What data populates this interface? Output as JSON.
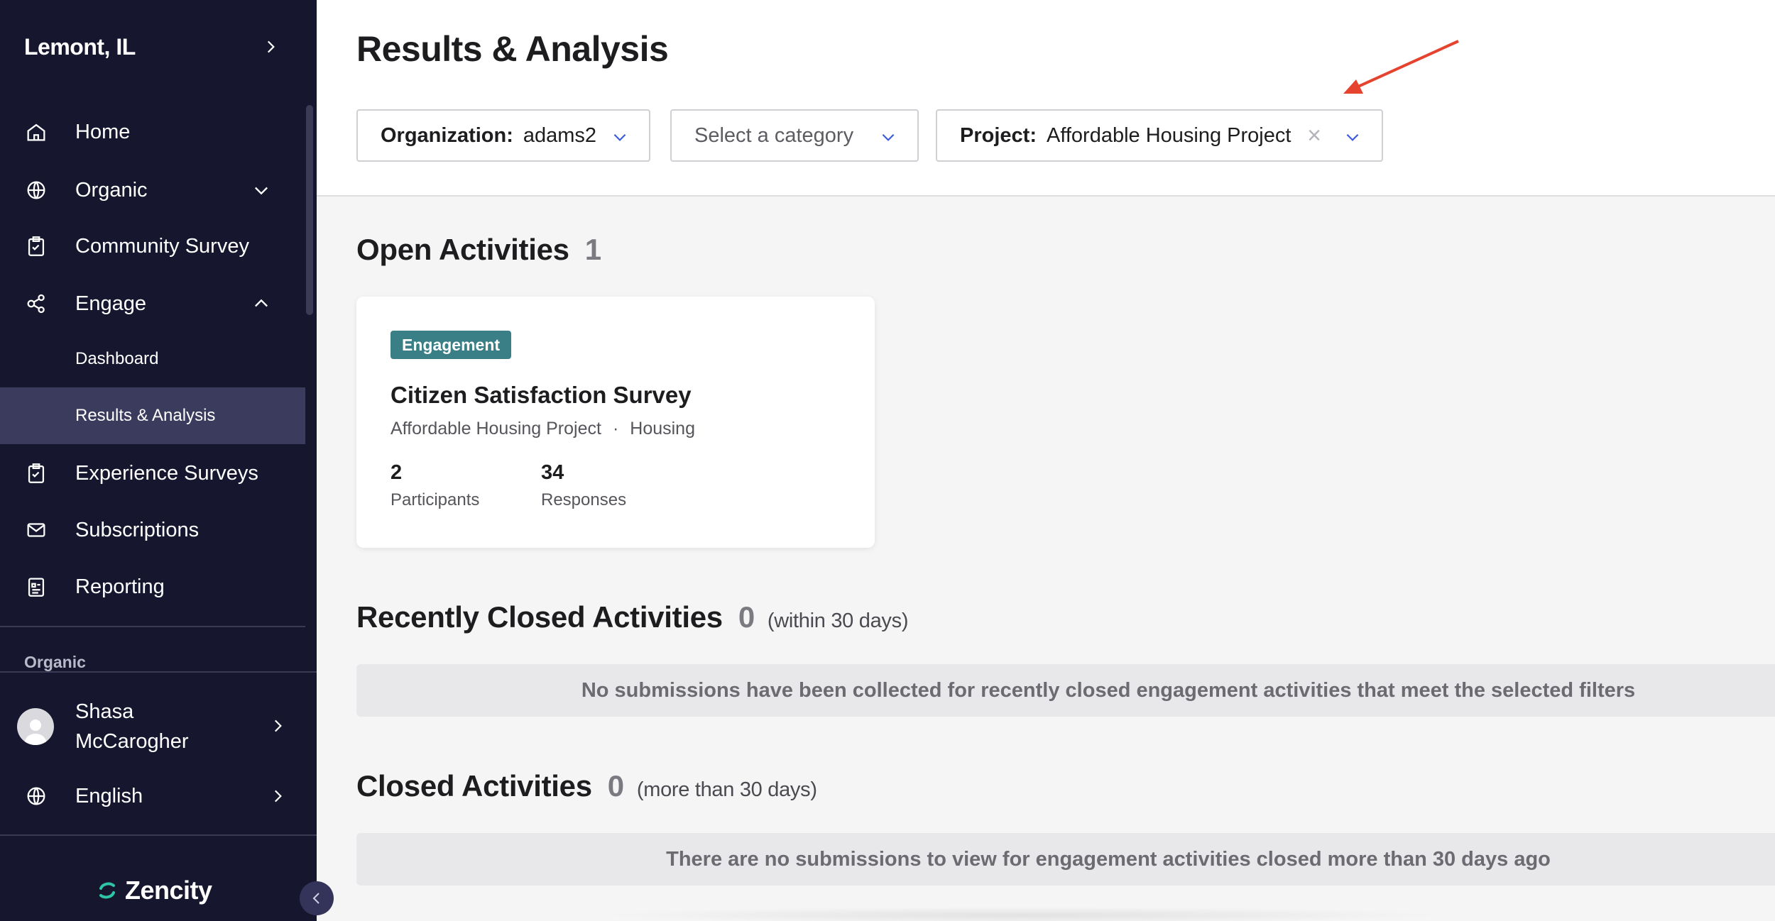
{
  "sidebar": {
    "city": "Lemont, IL",
    "nav": {
      "home": "Home",
      "organic": "Organic",
      "community_survey": "Community Survey",
      "engage": "Engage",
      "dashboard": "Dashboard",
      "results_analysis": "Results & Analysis",
      "experience_surveys": "Experience Surveys",
      "subscriptions": "Subscriptions",
      "reporting": "Reporting"
    },
    "section_label": "Organic",
    "user_name": "Shasa McCarogher",
    "language": "English",
    "brand": "Zencity",
    "colors": {
      "background": "#16162e",
      "active_item": "#3b3b5e",
      "brand_accent": "#2ec4a6"
    }
  },
  "header": {
    "title": "Results & Analysis",
    "filters": {
      "organization_label": "Organization:",
      "organization_value": "adams2",
      "category_placeholder": "Select a category",
      "project_label": "Project:",
      "project_value": "Affordable Housing Project"
    }
  },
  "open_activities": {
    "title": "Open Activities",
    "count": "1",
    "card": {
      "badge": "Engagement",
      "badge_color": "#3a7f86",
      "title": "Citizen Satisfaction Survey",
      "project": "Affordable Housing Project",
      "separator": "·",
      "category": "Housing",
      "participants_value": "2",
      "participants_label": "Participants",
      "responses_value": "34",
      "responses_label": "Responses"
    }
  },
  "recently_closed": {
    "title": "Recently Closed Activities",
    "count": "0",
    "note": "(within 30 days)",
    "empty_message": "No submissions have been collected for recently closed engagement activities that meet the selected filters"
  },
  "closed": {
    "title": "Closed Activities",
    "count": "0",
    "note": "(more than 30 days)",
    "empty_message": "There are no submissions to view for engagement activities closed more than 30 days ago"
  },
  "annotation": {
    "arrow_color": "#e5432e"
  }
}
